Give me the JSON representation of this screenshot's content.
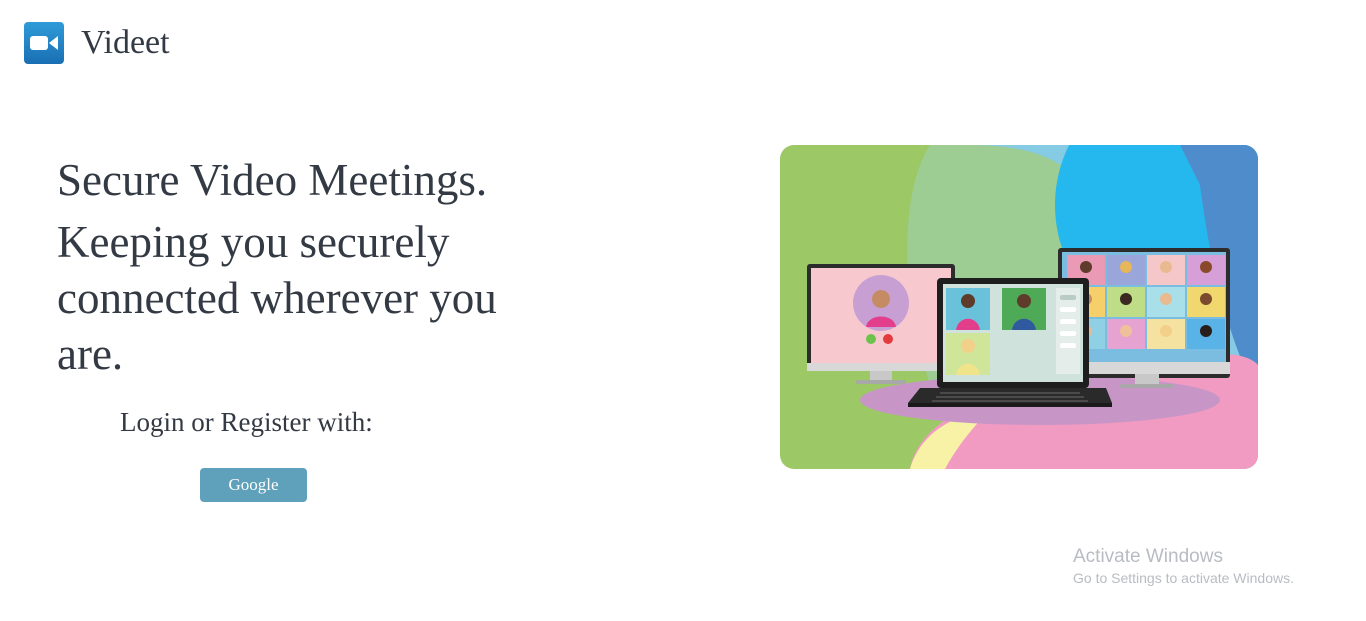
{
  "app": {
    "brand": "Videet",
    "logo_icon": "video-camera-icon",
    "accent_color": "#1a6fb3"
  },
  "hero": {
    "line1": "Secure Video Meetings.",
    "line2": "Keeping you securely",
    "line3": "connected wherever you",
    "line4": "are."
  },
  "login": {
    "label": "Login or Register with:",
    "google_button": "Google",
    "button_color": "#5fa0ba"
  },
  "illustration": {
    "icon": "video-conference-illustration"
  },
  "watermark": {
    "title": "Activate Windows",
    "subtitle": "Go to Settings to activate Windows."
  }
}
